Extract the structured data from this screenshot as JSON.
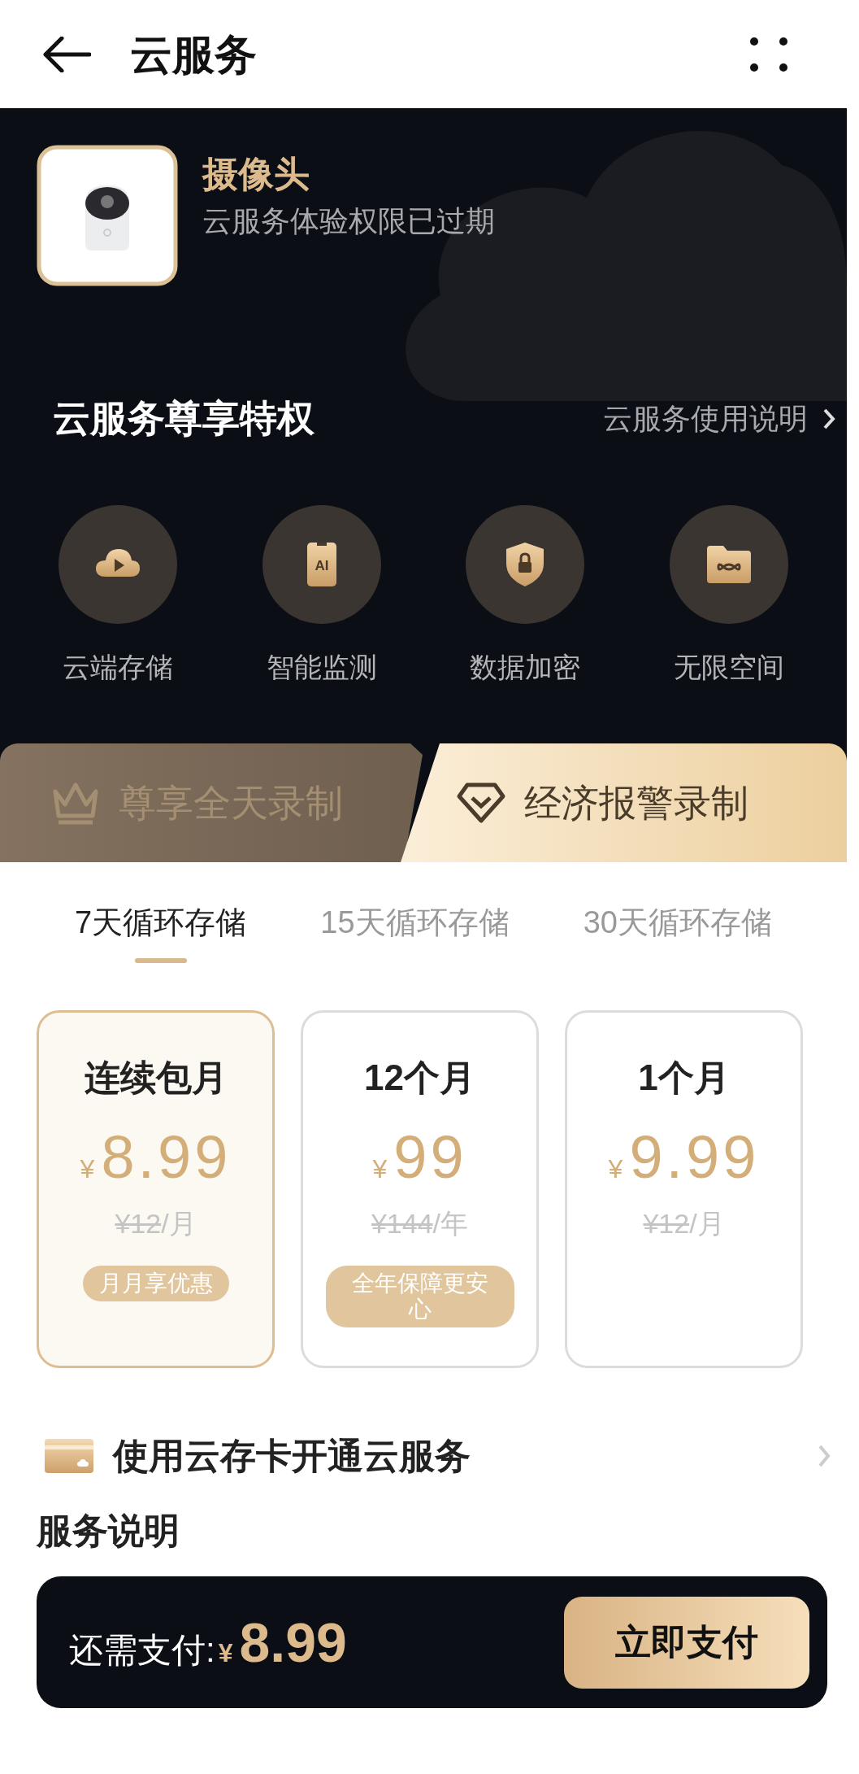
{
  "header": {
    "title": "云服务"
  },
  "device": {
    "name": "摄像头",
    "status": "云服务体验权限已过期"
  },
  "privileges": {
    "title": "云服务尊享特权",
    "link": "云服务使用说明",
    "features": [
      {
        "kind": "cloud",
        "label": "云端存储"
      },
      {
        "kind": "ai",
        "icon_text": "AI",
        "label": "智能监测"
      },
      {
        "kind": "lock",
        "label": "数据加密"
      },
      {
        "kind": "folder",
        "label": "无限空间"
      }
    ]
  },
  "plan_tabs": [
    {
      "kind": "crown",
      "label": "尊享全天录制",
      "selected": false
    },
    {
      "kind": "diamond",
      "label": "经济报警录制",
      "selected": true
    }
  ],
  "storage_tabs": [
    {
      "label": "7天循环存储",
      "selected": true
    },
    {
      "label": "15天循环存储",
      "selected": false
    },
    {
      "label": "30天循环存储",
      "selected": false
    }
  ],
  "plans": [
    {
      "title": "连续包月",
      "currency": "¥",
      "price": "8.99",
      "original_price": "¥12",
      "unit": "/月",
      "badge": "月月享优惠",
      "selected": true
    },
    {
      "title": "12个月",
      "currency": "¥",
      "price": "99",
      "original_price": "¥144",
      "unit": "/年",
      "badge": "全年保障更安心",
      "selected": false
    },
    {
      "title": "1个月",
      "currency": "¥",
      "price": "9.99",
      "original_price": "¥12",
      "unit": "/月",
      "selected": false
    }
  ],
  "card_option": {
    "label": "使用云存卡开通云服务"
  },
  "section_title": "服务说明",
  "pay_bar": {
    "label": "还需支付:",
    "currency": "¥",
    "amount": "8.99",
    "button": "立即支付"
  }
}
